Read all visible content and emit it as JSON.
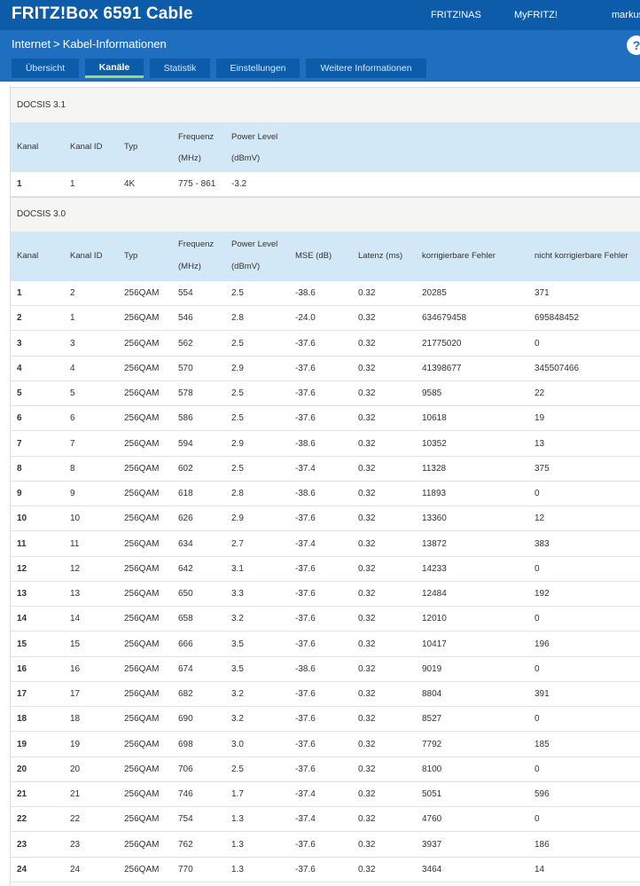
{
  "app": {
    "title": "FRITZ!Box 6591 Cable",
    "nav": [
      "FRITZ!NAS",
      "MyFRITZ!",
      "markus"
    ],
    "help": "?"
  },
  "breadcrumb": [
    "Internet",
    "Kabel-Informationen"
  ],
  "breadcrumb_separator": ">",
  "tabs": [
    {
      "label": "Übersicht",
      "active": false
    },
    {
      "label": "Kanäle",
      "active": true
    },
    {
      "label": "Statistik",
      "active": false
    },
    {
      "label": "Einstellungen",
      "active": false
    },
    {
      "label": "Weitere Informationen",
      "active": false
    }
  ],
  "colors": {
    "header": "#1f6fc1",
    "topbar": "#0d5ca9",
    "tab_active_underline": "#9bd47b",
    "table_header": "#d3e8f6",
    "section_bg": "#f5f5f4"
  },
  "docsis31": {
    "title": "DOCSIS 3.1",
    "headers": {
      "kanal": "Kanal",
      "kanal_id": "Kanal ID",
      "typ": "Typ",
      "frequenz_1": "Frequenz",
      "frequenz_2": "(MHz)",
      "power_1": "Power Level",
      "power_2": "(dBmV)"
    },
    "rows": [
      {
        "kanal": "1",
        "kanal_id": "1",
        "typ": "4K",
        "frequenz": "775 - 861",
        "power": "-3.2"
      }
    ]
  },
  "docsis30": {
    "title": "DOCSIS 3.0",
    "headers": {
      "kanal": "Kanal",
      "kanal_id": "Kanal ID",
      "typ": "Typ",
      "frequenz_1": "Frequenz",
      "frequenz_2": "(MHz)",
      "power_1": "Power Level",
      "power_2": "(dBmV)",
      "mse": "MSE (dB)",
      "latenz": "Latenz (ms)",
      "korr": "korrigierbare Fehler",
      "nkorr": "nicht korrigierbare Fehler"
    },
    "rows": [
      {
        "kanal": "1",
        "kanal_id": "2",
        "typ": "256QAM",
        "frequenz": "554",
        "power": "2.5",
        "mse": "-38.6",
        "latenz": "0.32",
        "korr": "20285",
        "nkorr": "371"
      },
      {
        "kanal": "2",
        "kanal_id": "1",
        "typ": "256QAM",
        "frequenz": "546",
        "power": "2.8",
        "mse": "-24.0",
        "latenz": "0.32",
        "korr": "634679458",
        "nkorr": "695848452"
      },
      {
        "kanal": "3",
        "kanal_id": "3",
        "typ": "256QAM",
        "frequenz": "562",
        "power": "2.5",
        "mse": "-37.6",
        "latenz": "0.32",
        "korr": "21775020",
        "nkorr": "0"
      },
      {
        "kanal": "4",
        "kanal_id": "4",
        "typ": "256QAM",
        "frequenz": "570",
        "power": "2.9",
        "mse": "-37.6",
        "latenz": "0.32",
        "korr": "41398677",
        "nkorr": "345507466"
      },
      {
        "kanal": "5",
        "kanal_id": "5",
        "typ": "256QAM",
        "frequenz": "578",
        "power": "2.5",
        "mse": "-37.6",
        "latenz": "0.32",
        "korr": "9585",
        "nkorr": "22"
      },
      {
        "kanal": "6",
        "kanal_id": "6",
        "typ": "256QAM",
        "frequenz": "586",
        "power": "2.5",
        "mse": "-37.6",
        "latenz": "0.32",
        "korr": "10618",
        "nkorr": "19"
      },
      {
        "kanal": "7",
        "kanal_id": "7",
        "typ": "256QAM",
        "frequenz": "594",
        "power": "2.9",
        "mse": "-38.6",
        "latenz": "0.32",
        "korr": "10352",
        "nkorr": "13"
      },
      {
        "kanal": "8",
        "kanal_id": "8",
        "typ": "256QAM",
        "frequenz": "602",
        "power": "2.5",
        "mse": "-37.4",
        "latenz": "0.32",
        "korr": "11328",
        "nkorr": "375"
      },
      {
        "kanal": "9",
        "kanal_id": "9",
        "typ": "256QAM",
        "frequenz": "618",
        "power": "2.8",
        "mse": "-38.6",
        "latenz": "0.32",
        "korr": "11893",
        "nkorr": "0"
      },
      {
        "kanal": "10",
        "kanal_id": "10",
        "typ": "256QAM",
        "frequenz": "626",
        "power": "2.9",
        "mse": "-37.6",
        "latenz": "0.32",
        "korr": "13360",
        "nkorr": "12"
      },
      {
        "kanal": "11",
        "kanal_id": "11",
        "typ": "256QAM",
        "frequenz": "634",
        "power": "2.7",
        "mse": "-37.4",
        "latenz": "0.32",
        "korr": "13872",
        "nkorr": "383"
      },
      {
        "kanal": "12",
        "kanal_id": "12",
        "typ": "256QAM",
        "frequenz": "642",
        "power": "3.1",
        "mse": "-37.6",
        "latenz": "0.32",
        "korr": "14233",
        "nkorr": "0"
      },
      {
        "kanal": "13",
        "kanal_id": "13",
        "typ": "256QAM",
        "frequenz": "650",
        "power": "3.3",
        "mse": "-37.6",
        "latenz": "0.32",
        "korr": "12484",
        "nkorr": "192"
      },
      {
        "kanal": "14",
        "kanal_id": "14",
        "typ": "256QAM",
        "frequenz": "658",
        "power": "3.2",
        "mse": "-37.6",
        "latenz": "0.32",
        "korr": "12010",
        "nkorr": "0"
      },
      {
        "kanal": "15",
        "kanal_id": "15",
        "typ": "256QAM",
        "frequenz": "666",
        "power": "3.5",
        "mse": "-37.6",
        "latenz": "0.32",
        "korr": "10417",
        "nkorr": "196"
      },
      {
        "kanal": "16",
        "kanal_id": "16",
        "typ": "256QAM",
        "frequenz": "674",
        "power": "3.5",
        "mse": "-38.6",
        "latenz": "0.32",
        "korr": "9019",
        "nkorr": "0"
      },
      {
        "kanal": "17",
        "kanal_id": "17",
        "typ": "256QAM",
        "frequenz": "682",
        "power": "3.2",
        "mse": "-37.6",
        "latenz": "0.32",
        "korr": "8804",
        "nkorr": "391"
      },
      {
        "kanal": "18",
        "kanal_id": "18",
        "typ": "256QAM",
        "frequenz": "690",
        "power": "3.2",
        "mse": "-37.6",
        "latenz": "0.32",
        "korr": "8527",
        "nkorr": "0"
      },
      {
        "kanal": "19",
        "kanal_id": "19",
        "typ": "256QAM",
        "frequenz": "698",
        "power": "3.0",
        "mse": "-37.6",
        "latenz": "0.32",
        "korr": "7792",
        "nkorr": "185"
      },
      {
        "kanal": "20",
        "kanal_id": "20",
        "typ": "256QAM",
        "frequenz": "706",
        "power": "2.5",
        "mse": "-37.6",
        "latenz": "0.32",
        "korr": "8100",
        "nkorr": "0"
      },
      {
        "kanal": "21",
        "kanal_id": "21",
        "typ": "256QAM",
        "frequenz": "746",
        "power": "1.7",
        "mse": "-37.4",
        "latenz": "0.32",
        "korr": "5051",
        "nkorr": "596"
      },
      {
        "kanal": "22",
        "kanal_id": "22",
        "typ": "256QAM",
        "frequenz": "754",
        "power": "1.3",
        "mse": "-37.4",
        "latenz": "0.32",
        "korr": "4760",
        "nkorr": "0"
      },
      {
        "kanal": "23",
        "kanal_id": "23",
        "typ": "256QAM",
        "frequenz": "762",
        "power": "1.3",
        "mse": "-37.6",
        "latenz": "0.32",
        "korr": "3937",
        "nkorr": "186"
      },
      {
        "kanal": "24",
        "kanal_id": "24",
        "typ": "256QAM",
        "frequenz": "770",
        "power": "1.3",
        "mse": "-37.6",
        "latenz": "0.32",
        "korr": "3464",
        "nkorr": "14"
      }
    ]
  }
}
